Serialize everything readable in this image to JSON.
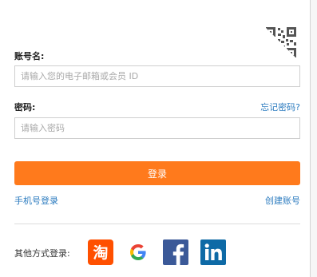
{
  "login": {
    "account_label": "账号名:",
    "account_placeholder": "请输入您的电子邮箱或会员 ID",
    "password_label": "密码:",
    "forgot_password": "忘记密码?",
    "password_placeholder": "请输入密码",
    "submit_label": "登录",
    "phone_login": "手机号登录",
    "create_account": "创建账号"
  },
  "social": {
    "label": "其他方式登录:",
    "items": [
      {
        "name": "taobao-icon",
        "glyph": "淘",
        "color": "#ff5000"
      },
      {
        "name": "google-icon",
        "glyph": "G",
        "color": "#4285f4"
      },
      {
        "name": "facebook-icon",
        "glyph": "f",
        "color": "#3b5998"
      },
      {
        "name": "linkedin-icon",
        "glyph": "in",
        "color": "#0e6aa6"
      }
    ]
  },
  "colors": {
    "accent": "#ff7a1c",
    "link": "#2b7bbf"
  }
}
